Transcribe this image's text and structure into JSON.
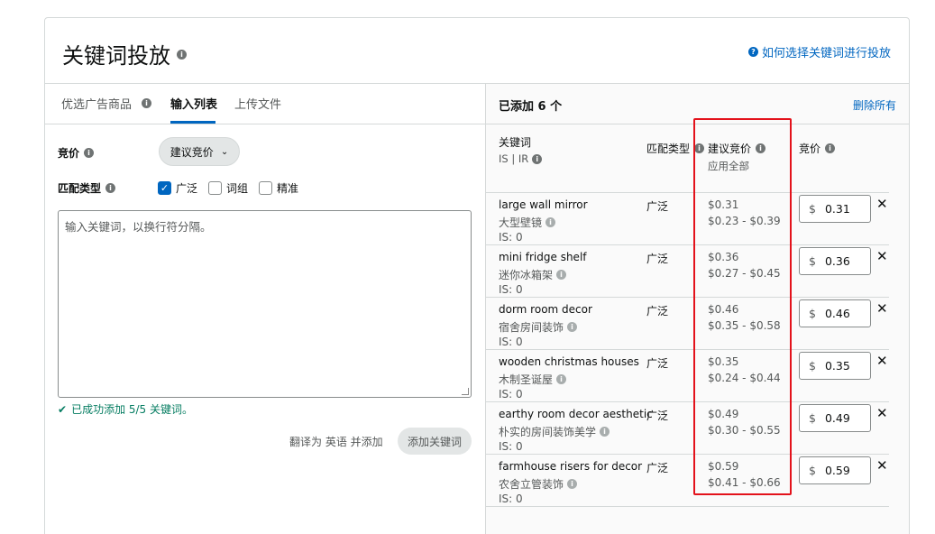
{
  "header": {
    "title": "关键词投放",
    "help_link": "如何选择关键词进行投放"
  },
  "tabs": [
    {
      "label": "优选广告商品"
    },
    {
      "label": "输入列表"
    },
    {
      "label": "上传文件"
    }
  ],
  "form": {
    "bid_label": "竞价",
    "bid_dropdown": "建议竞价",
    "match_label": "匹配类型",
    "match_options": [
      {
        "label": "广泛",
        "checked": true
      },
      {
        "label": "词组",
        "checked": false
      },
      {
        "label": "精准",
        "checked": false
      }
    ],
    "textarea_placeholder": "输入关键词，以换行符分隔。",
    "success_message": "已成功添加 5/5 关键词。",
    "translate_text": "翻译为 英语 并添加",
    "add_button": "添加关键词"
  },
  "right_panel": {
    "added_count": "已添加 6 个",
    "delete_all": "删除所有",
    "columns": {
      "keyword": "关键词",
      "keyword_sub": "IS | IR",
      "match_type": "匹配类型",
      "suggested_bid": "建议竞价",
      "suggested_sub": "应用全部",
      "bid": "竞价"
    },
    "rows": [
      {
        "keyword": "large wall mirror",
        "translation": "大型壁镜",
        "is": "IS:  0",
        "match": "广泛",
        "suggested": "$0.31",
        "range": "$0.23 - $0.39",
        "currency": "$",
        "bid": "0.31"
      },
      {
        "keyword": "mini fridge shelf",
        "translation": "迷你冰箱架",
        "is": "IS:  0",
        "match": "广泛",
        "suggested": "$0.36",
        "range": "$0.27 - $0.45",
        "currency": "$",
        "bid": "0.36"
      },
      {
        "keyword": "dorm room decor",
        "translation": "宿舍房间装饰",
        "is": "IS:  0",
        "match": "广泛",
        "suggested": "$0.46",
        "range": "$0.35 - $0.58",
        "currency": "$",
        "bid": "0.46"
      },
      {
        "keyword": "wooden christmas houses",
        "translation": "木制圣诞屋",
        "is": "IS:  0",
        "match": "广泛",
        "suggested": "$0.35",
        "range": "$0.24 - $0.44",
        "currency": "$",
        "bid": "0.35"
      },
      {
        "keyword": "earthy room decor aesthetic",
        "translation": "朴实的房间装饰美学",
        "is": "IS:  0",
        "match": "广泛",
        "suggested": "$0.49",
        "range": "$0.30 - $0.55",
        "currency": "$",
        "bid": "0.49"
      },
      {
        "keyword": "farmhouse risers for decor",
        "translation": "农舍立管装饰",
        "is": "IS:  0",
        "match": "广泛",
        "suggested": "$0.59",
        "range": "$0.41 - $0.66",
        "currency": "$",
        "bid": "0.59"
      }
    ]
  },
  "colors": {
    "accent": "#0066c0",
    "success": "#067d62",
    "highlight": "#e3121b"
  }
}
